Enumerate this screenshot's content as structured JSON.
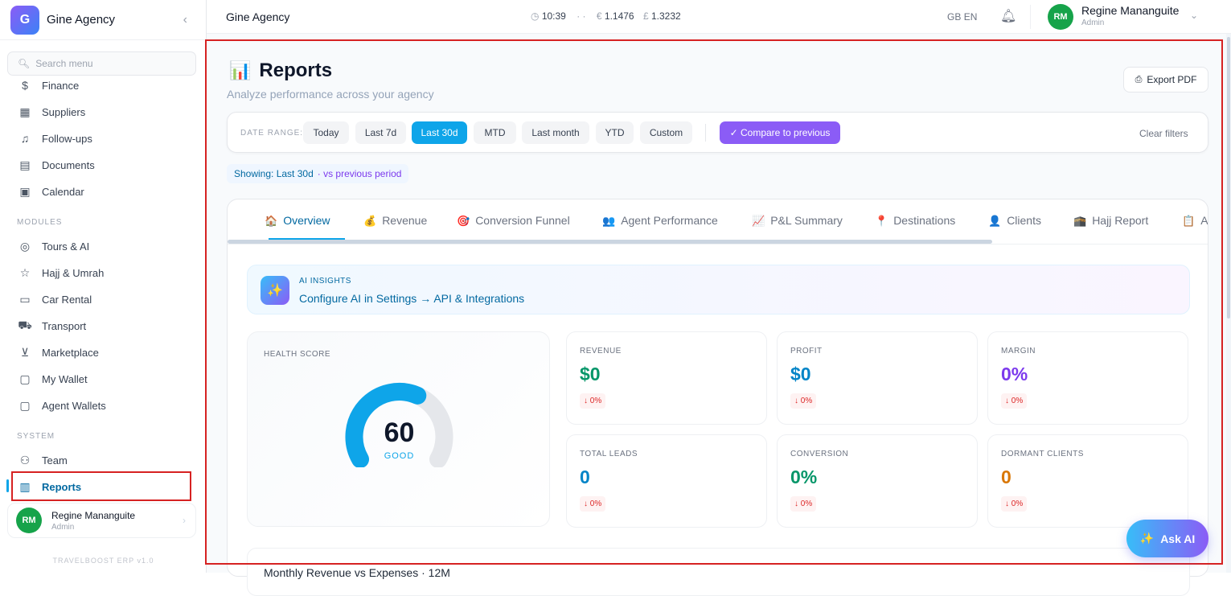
{
  "sidebar": {
    "brand_letter": "G",
    "brand_name": "Gine Agency",
    "collapse_icon": "chevron-left-icon",
    "search_placeholder": "Search menu",
    "items_top": [
      {
        "label": "Finance",
        "icon": "dollar-icon"
      },
      {
        "label": "Suppliers",
        "icon": "building-icon"
      },
      {
        "label": "Follow-ups",
        "icon": "bell-icon"
      },
      {
        "label": "Documents",
        "icon": "document-icon"
      },
      {
        "label": "Calendar",
        "icon": "calendar-icon"
      }
    ],
    "modules_label": "MODULES",
    "modules": [
      {
        "label": "Tours & AI",
        "icon": "globe-icon"
      },
      {
        "label": "Hajj & Umrah",
        "icon": "star-icon"
      },
      {
        "label": "Car Rental",
        "icon": "car-icon"
      },
      {
        "label": "Transport",
        "icon": "truck-icon"
      },
      {
        "label": "Marketplace",
        "icon": "cart-icon"
      },
      {
        "label": "My Wallet",
        "icon": "wallet-icon"
      },
      {
        "label": "Agent Wallets",
        "icon": "wallets-icon"
      }
    ],
    "system_label": "SYSTEM",
    "system": [
      {
        "label": "Team",
        "icon": "users-icon"
      },
      {
        "label": "Reports",
        "icon": "bar-chart-icon"
      }
    ],
    "user": {
      "initials": "RM",
      "name": "Regine Mananguite",
      "role": "Admin"
    },
    "version": "TRAVELBOOST ERP v1.0"
  },
  "topbar": {
    "title": "Gine Agency",
    "time": "10:39",
    "separator": "· ·",
    "eur_symbol": "€",
    "eur_rate": "1.1476",
    "gbp_symbol": "£",
    "gbp_rate": "1.3232",
    "lang_flag": "GB",
    "lang": "EN",
    "user": {
      "initials": "RM",
      "name": "Regine Mananguite",
      "role": "Admin"
    }
  },
  "page": {
    "title_emoji": "📊",
    "title": "Reports",
    "subtitle": "Analyze performance across your agency",
    "export_label": "Export PDF"
  },
  "filters": {
    "label": "DATE RANGE:",
    "chips": [
      "Today",
      "Last 7d",
      "Last 30d",
      "MTD",
      "Last month",
      "YTD",
      "Custom"
    ],
    "active_index": 2,
    "compare_label": "✓ Compare to previous",
    "clear_label": "Clear filters"
  },
  "showing": {
    "main": "Showing: Last 30d",
    "compare": "· vs previous period"
  },
  "tabs": [
    {
      "emoji": "🏠",
      "label": "Overview"
    },
    {
      "emoji": "💰",
      "label": "Revenue"
    },
    {
      "emoji": "🎯",
      "label": "Conversion Funnel"
    },
    {
      "emoji": "👥",
      "label": "Agent Performance"
    },
    {
      "emoji": "📈",
      "label": "P&L Summary"
    },
    {
      "emoji": "📍",
      "label": "Destinations"
    },
    {
      "emoji": "👤",
      "label": "Clients"
    },
    {
      "emoji": "🕋",
      "label": "Hajj Report"
    },
    {
      "emoji": "📋",
      "label": "A"
    }
  ],
  "insights": {
    "icon": "✨",
    "label": "AI INSIGHTS",
    "text": "Configure AI in Settings → API & Integrations"
  },
  "health": {
    "label": "HEALTH SCORE",
    "score": 60,
    "max": 100,
    "status": "GOOD"
  },
  "kpis": [
    {
      "label": "REVENUE",
      "value": "$0",
      "change": "↓ 0%",
      "color": "#059669"
    },
    {
      "label": "PROFIT",
      "value": "$0",
      "change": "↓ 0%",
      "color": "#0284c7"
    },
    {
      "label": "MARGIN",
      "value": "0%",
      "change": "↓ 0%",
      "color": "#7c3aed"
    },
    {
      "label": "TOTAL LEADS",
      "value": "0",
      "change": "↓ 0%",
      "color": "#0284c7"
    },
    {
      "label": "CONVERSION",
      "value": "0%",
      "change": "↓ 0%",
      "color": "#059669"
    },
    {
      "label": "DORMANT CLIENTS",
      "value": "0",
      "change": "↓ 0%",
      "color": "#d97706"
    }
  ],
  "chart_section": {
    "title": "Monthly Revenue vs Expenses · 12M"
  },
  "ask_ai": {
    "icon": "✨",
    "label": "Ask AI"
  }
}
